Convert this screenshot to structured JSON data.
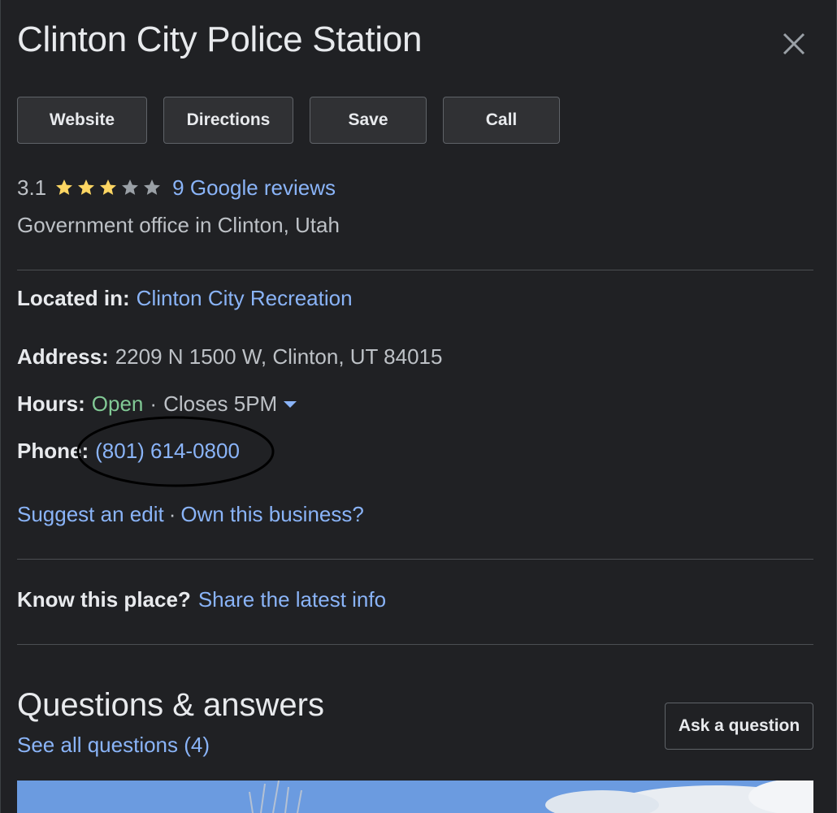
{
  "place": {
    "title": "Clinton City Police Station",
    "rating": "3.1",
    "stars": {
      "filled": 3,
      "total": 5
    },
    "reviews_link": "9 Google reviews",
    "category": "Government office in Clinton, Utah"
  },
  "actions": {
    "website": "Website",
    "directions": "Directions",
    "save": "Save",
    "call": "Call"
  },
  "details": {
    "located_in_label": "Located in:",
    "located_in_value": "Clinton City Recreation",
    "address_label": "Address:",
    "address_value": "2209 N 1500 W, Clinton, UT 84015",
    "hours_label": "Hours:",
    "hours_status": "Open",
    "hours_separator": "·",
    "hours_closes": "Closes 5PM",
    "phone_label": "Phone:",
    "phone_value": "(801) 614-0800"
  },
  "edit": {
    "suggest": "Suggest an edit",
    "separator": "·",
    "own": "Own this business?"
  },
  "know": {
    "label": "Know this place?",
    "link": "Share the latest info"
  },
  "qa": {
    "title": "Questions & answers",
    "see_all": "See all questions (4)",
    "ask": "Ask a question"
  },
  "icons": {
    "close": "close-icon",
    "star": "star-icon",
    "hours_dropdown": "chevron-down-icon"
  },
  "colors": {
    "background": "#202124",
    "link": "#8ab4f8",
    "open": "#81c995",
    "star_filled": "#fdd663",
    "star_empty": "#9aa0a6"
  }
}
